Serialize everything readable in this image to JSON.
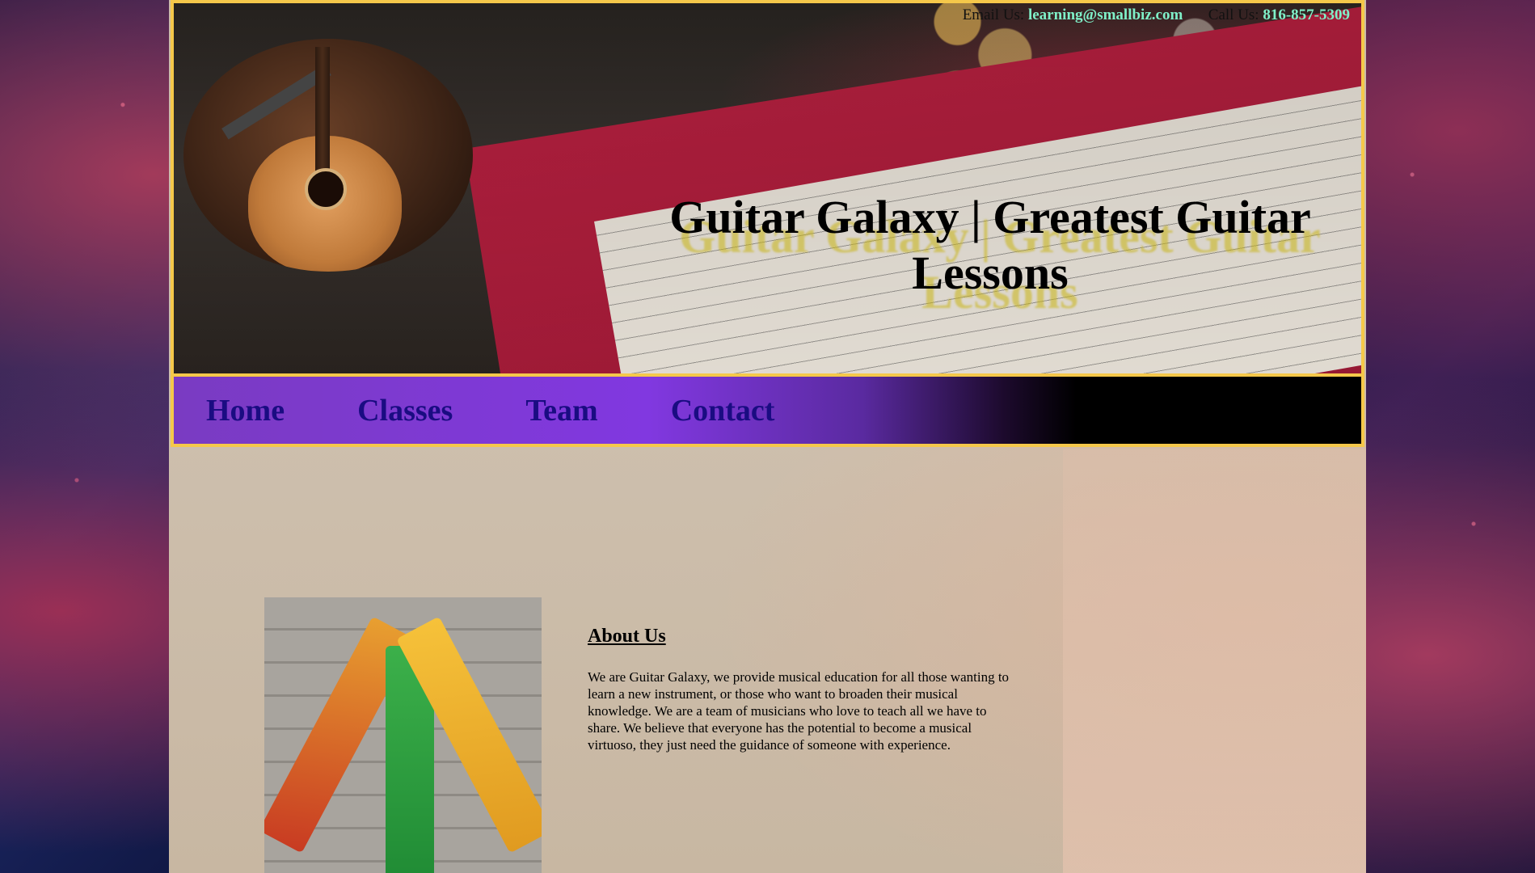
{
  "header": {
    "contact": {
      "email_label": "Email Us:",
      "email_value": "learning@smallbiz.com",
      "phone_label": "Call Us:",
      "phone_value": "816-857-5309"
    },
    "title": "Guitar Galaxy | Greatest Guitar Lessons"
  },
  "nav": {
    "items": [
      "Home",
      "Classes",
      "Team",
      "Contact"
    ]
  },
  "about": {
    "heading": "About Us",
    "body": "We are Guitar Galaxy, we provide musical education for all those wanting to learn a new instrument, or those who want to broaden their musical knowledge. We are a team of musicians who love to teach all we have to share. We believe that everyone has the potential to become a musical virtuoso, they just need the guidance of someone with experience."
  },
  "colors": {
    "border": "#f5c84a",
    "nav_link": "#1a0c82",
    "contact_value": "#7ff0c8"
  }
}
